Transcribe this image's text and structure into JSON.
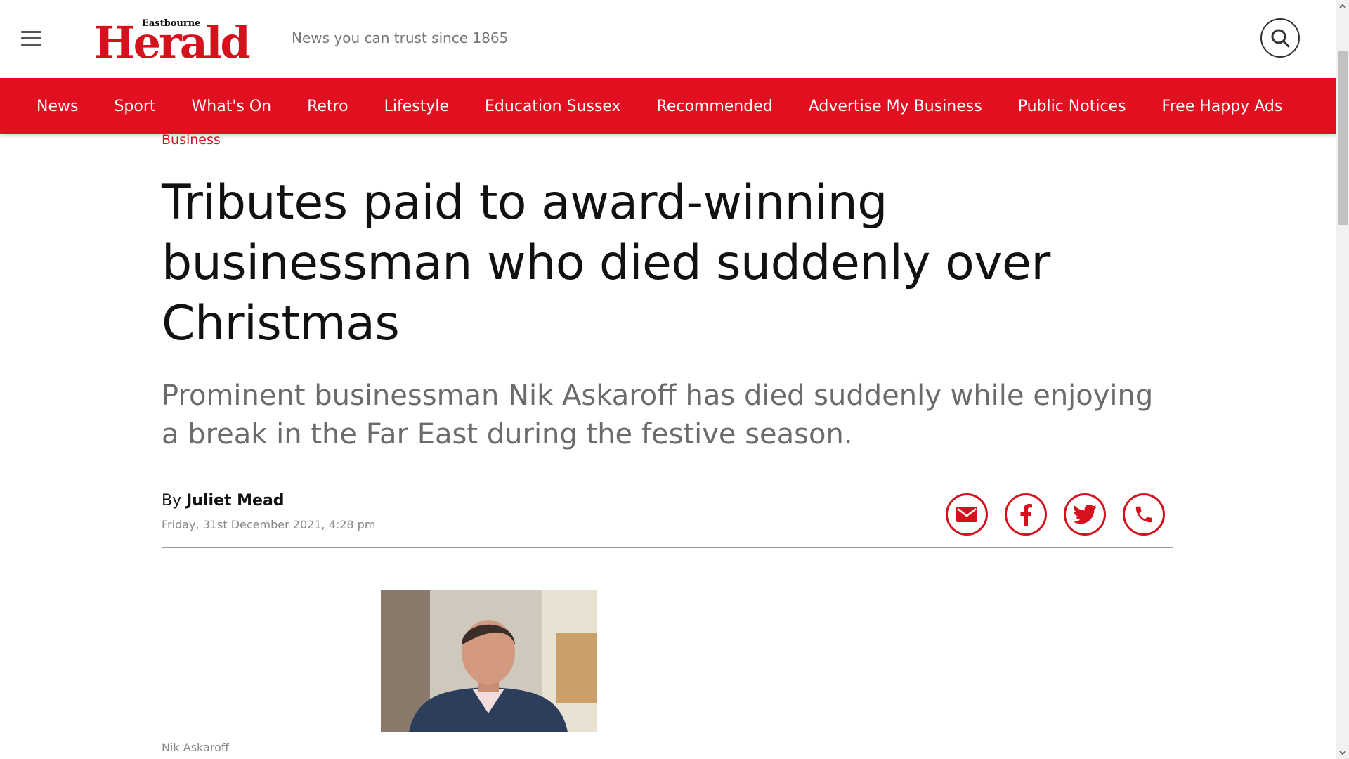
{
  "header": {
    "logo_small": "Eastbourne",
    "logo_big": "Herald",
    "tagline": "News you can trust since 1865",
    "menu_icon": "hamburger-menu-icon",
    "search_icon": "search-icon"
  },
  "nav": {
    "items": [
      "News",
      "Sport",
      "What's On",
      "Retro",
      "Lifestyle",
      "Education Sussex",
      "Recommended",
      "Advertise My Business",
      "Public Notices",
      "Free Happy Ads"
    ]
  },
  "article": {
    "category": "Business",
    "headline": "Tributes paid to award-winning businessman who died suddenly over Christmas",
    "standfirst": "Prominent businessman Nik Askaroff has died suddenly while enjoying a break in the Far East during the festive season.",
    "byline_prefix": "By",
    "author": "Juliet Mead",
    "date": "Friday, 31st December 2021, 4:28 pm",
    "image_caption": "Nik Askaroff"
  },
  "share": {
    "icons": [
      "email-icon",
      "facebook-icon",
      "twitter-icon",
      "whatsapp-icon"
    ]
  },
  "colors": {
    "brand_red": "#e20f20",
    "text": "#111111",
    "muted": "#6b6b6b"
  }
}
